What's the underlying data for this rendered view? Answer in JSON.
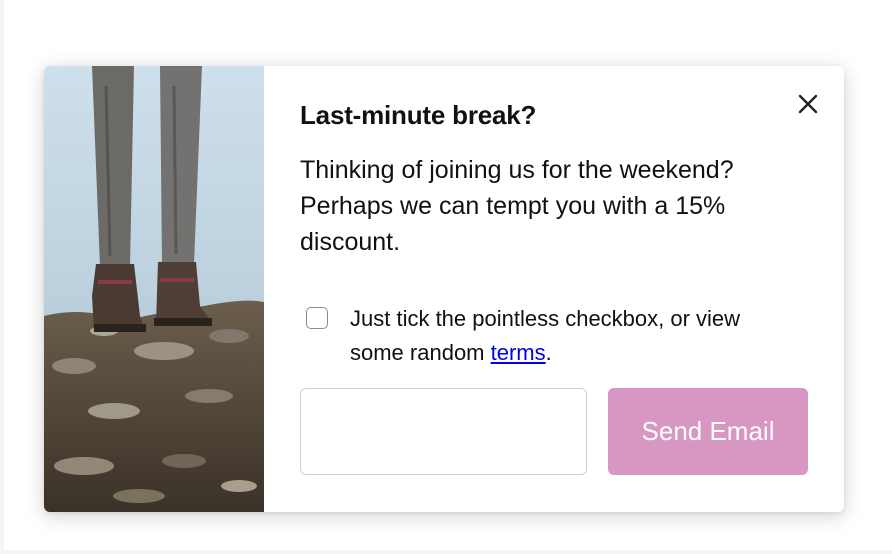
{
  "popup": {
    "title": "Last-minute break?",
    "description": "Thinking of joining us for the weekend? Perhaps we can tempt you with a 15% discount.",
    "consent_text_before": "Just tick the pointless checkbox, or view some random ",
    "terms_link": "terms",
    "consent_text_after": ".",
    "checkbox_checked": false,
    "email_value": "",
    "email_placeholder": "",
    "send_button": "Send Email",
    "close_icon": "close-icon",
    "image": "hiker-boots-photo"
  },
  "colors": {
    "send_button_bg": "#d897c3",
    "link": "#0000ee",
    "text": "#111111"
  }
}
